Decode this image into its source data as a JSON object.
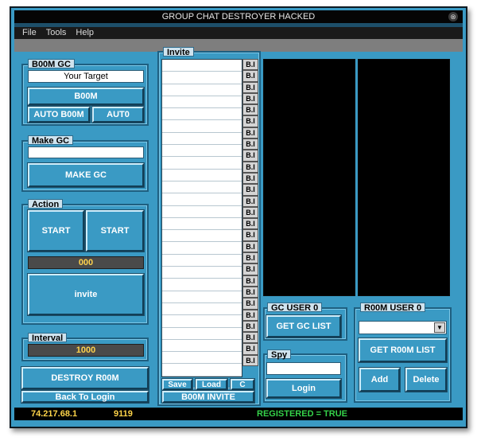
{
  "window": {
    "title": "GROUP CHAT DESTROYER HACKED",
    "close_glyph": "⊗"
  },
  "menu": [
    "File",
    "Tools",
    "Help"
  ],
  "boom": {
    "label": "B00M GC",
    "target_value": "Your Target",
    "boom_btn": "B00M",
    "auto_boom_btn": "AUTO B00M",
    "auto_btn": "AUT0"
  },
  "make": {
    "label": "Make GC",
    "value": "",
    "make_btn": "MAKE GC"
  },
  "action": {
    "label": "Action",
    "start1": "START",
    "start2": "START",
    "counter": "000",
    "invite_btn": "invite"
  },
  "interval": {
    "label": "Interval",
    "value": "1000"
  },
  "bottom_left": {
    "destroy_btn": "DESTROY R00M",
    "back_btn": "Back To Login"
  },
  "invite": {
    "label": "Invite",
    "row_count": 27,
    "bi_label": "B.I",
    "save_btn": "Save",
    "load_btn": "Load",
    "c_btn": "C",
    "boom_invite_btn": "B00M INVITE"
  },
  "gc_user": {
    "label": "GC USER  0",
    "get_btn": "GET GC LIST"
  },
  "spy": {
    "label": "Spy",
    "value": "",
    "login_btn": "Login"
  },
  "room_user": {
    "label": "R00M USER  0",
    "select_value": "",
    "get_btn": "GET R00M LIST",
    "add_btn": "Add",
    "delete_btn": "Delete"
  },
  "status": {
    "ip": "74.217.68.1",
    "port": "9119",
    "registered": "REGISTERED = TRUE",
    "registered_color": "#35d24a"
  }
}
